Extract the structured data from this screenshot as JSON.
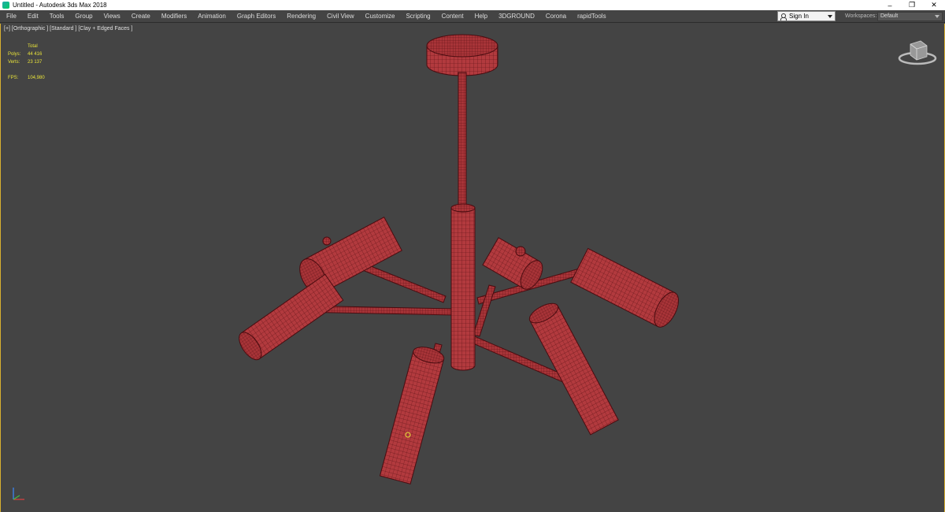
{
  "window": {
    "title": "Untitled - Autodesk 3ds Max 2018",
    "controls": [
      "–",
      "❐",
      "✕"
    ]
  },
  "menu": [
    "File",
    "Edit",
    "Tools",
    "Group",
    "Views",
    "Create",
    "Modifiers",
    "Animation",
    "Graph Editors",
    "Rendering",
    "Civil View",
    "Customize",
    "Scripting",
    "Content",
    "Help",
    "3DGROUND",
    "Corona",
    "rapidTools"
  ],
  "account": {
    "sign_in_label": "Sign In"
  },
  "workspaces": {
    "label": "Workspaces:",
    "value": "Default"
  },
  "viewport": {
    "label": "[+] [Orthographic ] [Standard ] [Clay + Edged Faces ]",
    "stats": {
      "header": "Total",
      "polys_label": "Polys:",
      "polys_value": "44 416",
      "verts_label": "Verts:",
      "verts_value": "23 137",
      "fps_label": "FPS:",
      "fps_value": "104,980"
    }
  },
  "colors": {
    "viewport_bg": "#444444",
    "clay": "#b23a3e",
    "wire": "#5c1216",
    "stats_text": "#e8e23a",
    "active_border": "#d8b030"
  },
  "icons": {
    "viewcube": "viewcube-icon",
    "axis": "axis-tripod-icon",
    "user": "person-icon"
  }
}
